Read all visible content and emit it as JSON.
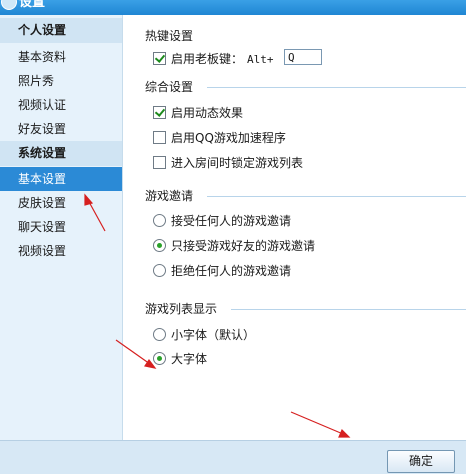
{
  "window": {
    "title": "设置"
  },
  "sidebar": {
    "sections": [
      {
        "title": "个人设置",
        "items": [
          "基本资料",
          "照片秀",
          "视频认证",
          "好友设置"
        ]
      },
      {
        "title": "系统设置",
        "items": [
          "基本设置",
          "皮肤设置",
          "聊天设置",
          "视频设置"
        ]
      }
    ],
    "active_item": "基本设置"
  },
  "hotkey": {
    "title": "热键设置",
    "enable_label": "启用老板键：",
    "enable_checked": true,
    "prefix": "Alt+",
    "key_value": "Q"
  },
  "general": {
    "title": "综合设置",
    "options": [
      {
        "label": "启用动态效果",
        "checked": true
      },
      {
        "label": "启用QQ游戏加速程序",
        "checked": false
      },
      {
        "label": "进入房间时锁定游戏列表",
        "checked": false
      }
    ]
  },
  "invite": {
    "title": "游戏邀请",
    "options": [
      {
        "label": "接受任何人的游戏邀请",
        "selected": false
      },
      {
        "label": "只接受游戏好友的游戏邀请",
        "selected": true
      },
      {
        "label": "拒绝任何人的游戏邀请",
        "selected": false
      }
    ]
  },
  "list_display": {
    "title": "游戏列表显示",
    "options": [
      {
        "label": "小字体（默认）",
        "selected": false
      },
      {
        "label": "大字体",
        "selected": true
      }
    ]
  },
  "footer": {
    "ok_label": "确定"
  },
  "colors": {
    "accent": "#2b8ad6",
    "sidebar_bg": "#e6f2fb",
    "annotation_arrow": "#d62020"
  }
}
